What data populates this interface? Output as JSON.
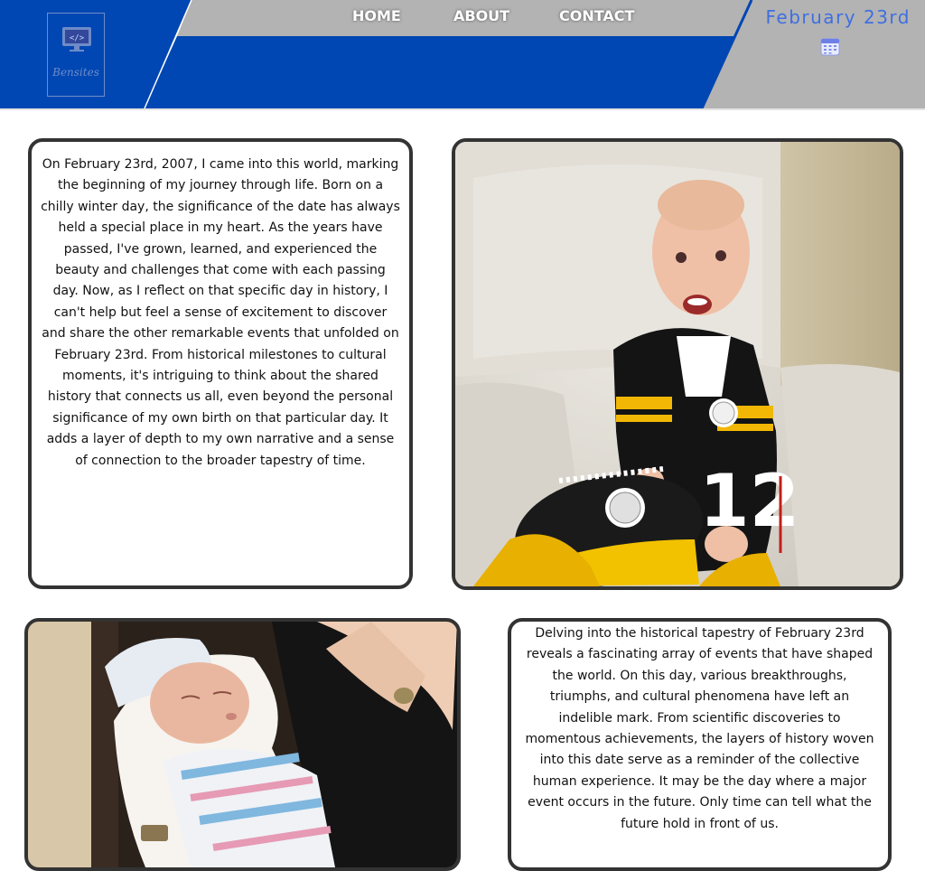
{
  "logo": {
    "brand": "Bensites",
    "icon": "monitor-code-icon"
  },
  "nav": [
    {
      "label": "HOME"
    },
    {
      "label": "ABOUT"
    },
    {
      "label": "CONTACT"
    }
  ],
  "header": {
    "date": "February 23rd",
    "calendar_icon": "calendar-icon"
  },
  "colors": {
    "primary_blue": "#0047b3",
    "gray": "#b3b3b3",
    "date_blue": "#3f6fe0",
    "border": "#333333"
  },
  "intro": {
    "text": "On February 23rd, 2007, I came into this world, marking the beginning of my journey through life. Born on a chilly winter day, the significance of the date has always held a special place in my heart. As the years have passed, I've grown, learned, and experienced the beauty and challenges that come with each passing day. Now, as I reflect on that specific day in history, I can't help but feel a sense of excitement to discover and share the other remarkable events that unfolded on February 23rd. From historical milestones to cultural moments, it's intriguing to think about the shared history that connects us all, even beyond the personal significance of my own birth on that particular day. It adds a layer of depth to my own narrative and a sense of connection to the broader tapestry of time."
  },
  "history": {
    "text": "Delving into the historical tapestry of February 23rd reveals a fascinating array of events that have shaped the world. On this day, various breakthroughs, triumphs, and cultural phenomena have left an indelible mark. From scientific discoveries to momentous achievements, the layers of history woven into this date serve as a reminder of the collective human experience. It may be the day where a major event occurs in the future. Only time can tell what the future hold in front of us."
  }
}
